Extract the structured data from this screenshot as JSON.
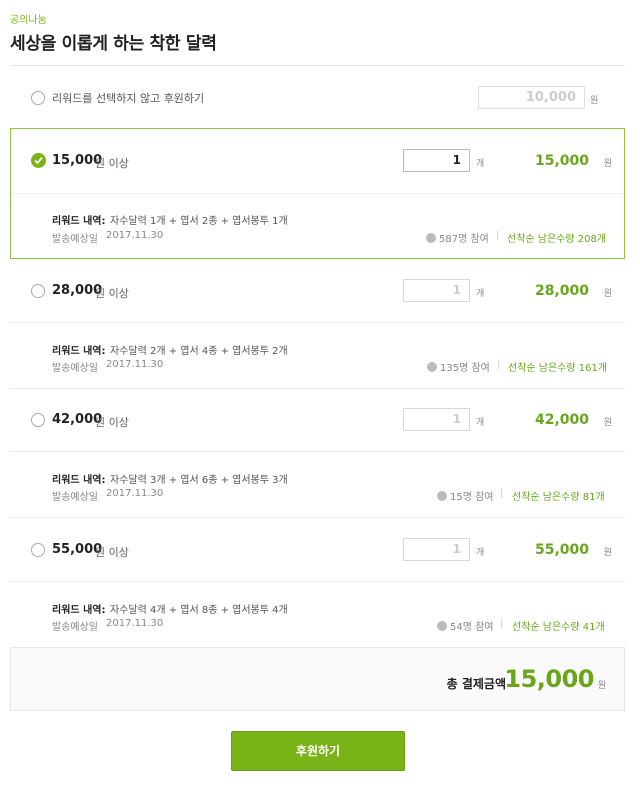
{
  "header": {
    "brand": "공의나눔",
    "title": "세상을 이롭게 하는 착한 달력"
  },
  "no_reward": {
    "label": "리워드를 선택하지 않고 후원하기",
    "placeholder": "10,000",
    "unit": "원"
  },
  "tiers": [
    {
      "amount": "15,000",
      "suffix": "원 이상",
      "selected": true,
      "qty": "1",
      "qty_unit": "개",
      "total": "15,000",
      "total_unit": "원",
      "reward_title": "리워드 내역:",
      "reward_desc": "자수달력 1개 + 엽서 2종 + 엽서봉투 1개",
      "ship_label": "발송예상일",
      "ship_date": "2017.11.30",
      "backers": "587명 참여",
      "sep": "|",
      "remaining": "선착순 남은수량 208개"
    },
    {
      "amount": "28,000",
      "suffix": "원 이상",
      "selected": false,
      "qty": "1",
      "qty_unit": "개",
      "total": "28,000",
      "total_unit": "원",
      "reward_title": "리워드 내역:",
      "reward_desc": "자수달력 2개 + 엽서 4종 + 엽서봉투 2개",
      "ship_label": "발송예상일",
      "ship_date": "2017.11.30",
      "backers": "135명 참여",
      "sep": "|",
      "remaining": "선착순 남은수량 161개"
    },
    {
      "amount": "42,000",
      "suffix": "원 이상",
      "selected": false,
      "qty": "1",
      "qty_unit": "개",
      "total": "42,000",
      "total_unit": "원",
      "reward_title": "리워드 내역:",
      "reward_desc": "자수달력 3개 + 엽서 6종 + 엽서봉투 3개",
      "ship_label": "발송예상일",
      "ship_date": "2017.11.30",
      "backers": "15명 참여",
      "sep": "|",
      "remaining": "선착순 남은수량 81개"
    },
    {
      "amount": "55,000",
      "suffix": "원 이상",
      "selected": false,
      "qty": "1",
      "qty_unit": "개",
      "total": "55,000",
      "total_unit": "원",
      "reward_title": "리워드 내역:",
      "reward_desc": "자수달력 4개 + 엽서 8종 + 엽서봉투 4개",
      "ship_label": "발송예상일",
      "ship_date": "2017.11.30",
      "backers": "54명 참여",
      "sep": "|",
      "remaining": "선착순 남은수량 41개"
    }
  ],
  "summary": {
    "label": "총 결제금액",
    "value": "15,000",
    "unit": "원"
  },
  "submit": {
    "label": "후원하기"
  },
  "colors": {
    "accent": "#7ab317",
    "accent_text": "#6aa51c",
    "border": "#e6e6e6"
  }
}
